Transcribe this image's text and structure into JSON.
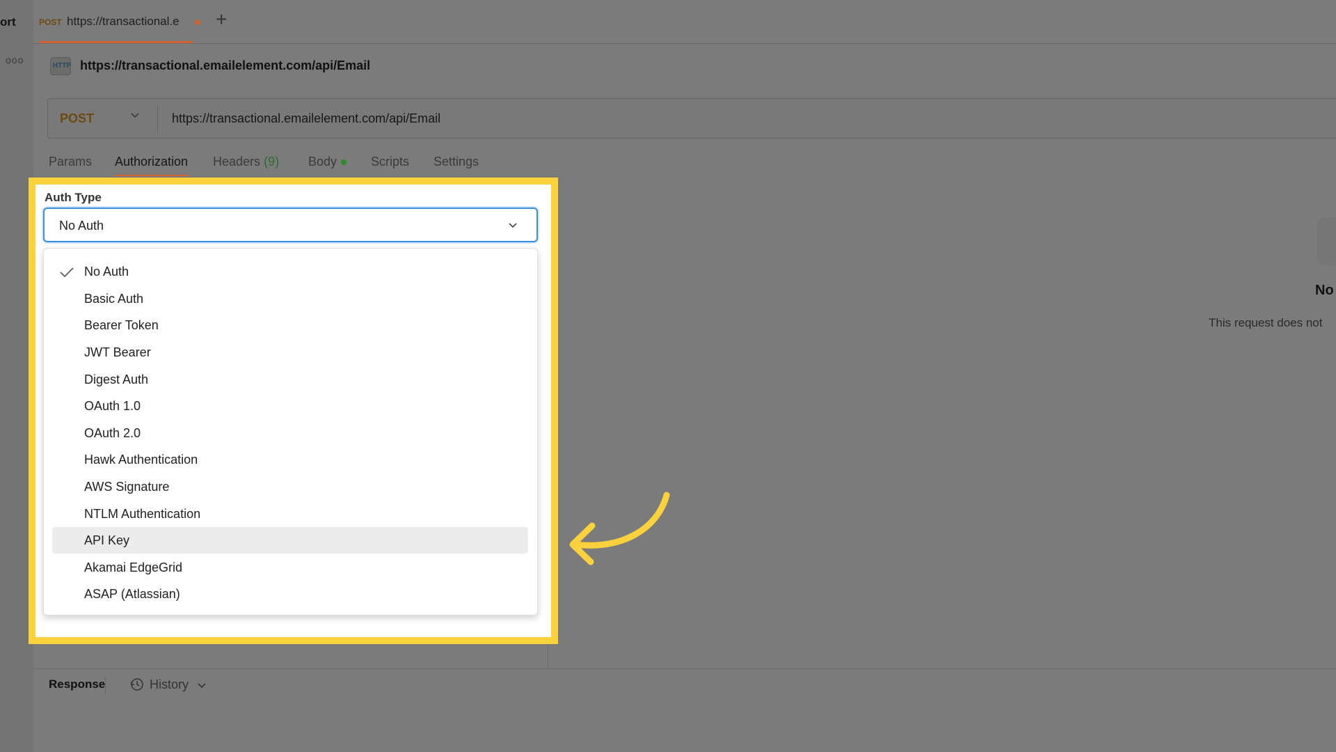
{
  "left_strip": {
    "partial_label": "ort",
    "more_icon": "ooo"
  },
  "tabs": [
    {
      "method": "POST",
      "url": "https://transactional.e",
      "unsaved": true
    }
  ],
  "new_tab_icon": "+",
  "request": {
    "icon_text": "HTTP",
    "title": "https://transactional.emailelement.com/api/Email",
    "method": "POST",
    "url": "https://transactional.emailelement.com/api/Email"
  },
  "request_tabs": {
    "params": "Params",
    "authorization": "Authorization",
    "headers": "Headers",
    "headers_count": "(9)",
    "body": "Body",
    "scripts": "Scripts",
    "settings": "Settings",
    "active": "Authorization"
  },
  "auth": {
    "label": "Auth Type",
    "selected": "No Auth",
    "hovered": "API Key",
    "options": [
      "No Auth",
      "Basic Auth",
      "Bearer Token",
      "JWT Bearer",
      "Digest Auth",
      "OAuth 1.0",
      "OAuth 2.0",
      "Hawk Authentication",
      "AWS Signature",
      "NTLM Authentication",
      "API Key",
      "Akamai EdgeGrid",
      "ASAP (Atlassian)"
    ]
  },
  "right_panel": {
    "title": "No",
    "description": "This request does not"
  },
  "response": {
    "label": "Response",
    "history": "History"
  },
  "colors": {
    "accent_orange": "#d0632f",
    "highlight_yellow": "#fbd13c",
    "focus_blue": "#3c8fe0",
    "overlay_gray": "#7b7b7b"
  }
}
